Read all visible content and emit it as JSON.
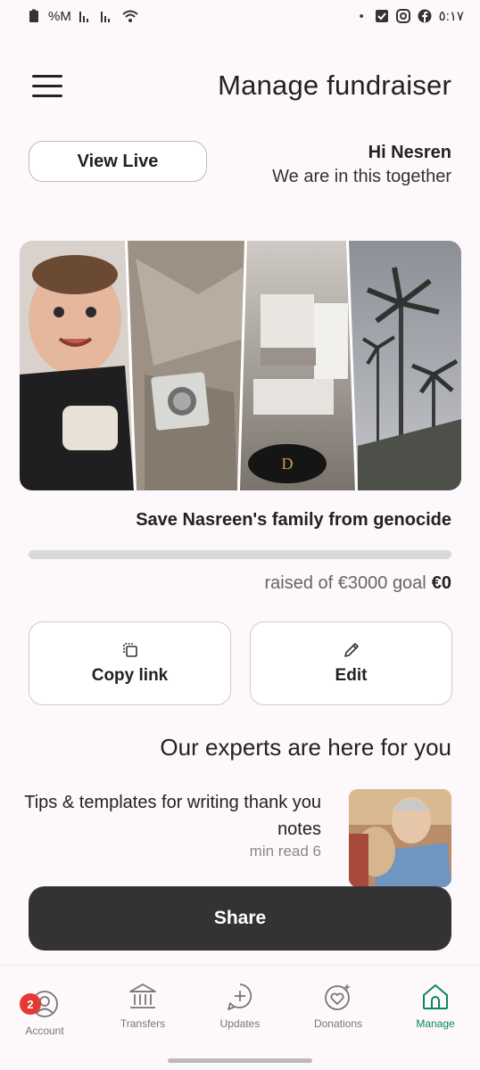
{
  "status_bar": {
    "left_text": "%M",
    "time": "٥:١٧",
    "icons": [
      "battery-icon",
      "signal-icon",
      "signal-icon",
      "wifi-icon",
      "dot-icon",
      "checkbox-icon",
      "instagram-icon",
      "facebook-icon"
    ]
  },
  "header": {
    "title": "Manage fundraiser",
    "menu_icon": "hamburger-menu-icon"
  },
  "greeting": {
    "view_live_label": "View Live",
    "name_line": "Hi Nesren",
    "subtitle": "We are in this together"
  },
  "fundraiser": {
    "title": "Save Nasreen's family from genocide",
    "raised_text": "raised of €3000 goal",
    "raised_amount": "€0",
    "progress_fraction": 0
  },
  "actions": {
    "copy_link_label": "Copy link",
    "copy_icon": "copy-icon",
    "edit_label": "Edit",
    "edit_icon": "pencil-icon"
  },
  "experts": {
    "title": "Our experts are here for you",
    "tip_title": "Tips & templates for writing thank you notes",
    "tip_meta": "min read 6"
  },
  "share_label": "Share",
  "nav": {
    "badge_count": "2",
    "items": [
      {
        "label": "Account",
        "icon": "account-icon"
      },
      {
        "label": "Transfers",
        "icon": "bank-icon"
      },
      {
        "label": "Updates",
        "icon": "add-update-icon"
      },
      {
        "label": "Donations",
        "icon": "heart-donations-icon"
      },
      {
        "label": "Manage",
        "icon": "home-icon"
      }
    ]
  },
  "colors": {
    "accent_green": "#02a95c",
    "share_button": "#333333",
    "badge_red": "#e53935",
    "background": "#fdf8fb"
  }
}
